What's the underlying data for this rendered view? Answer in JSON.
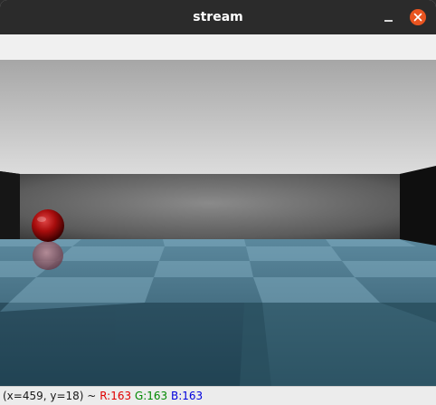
{
  "window": {
    "title": "stream"
  },
  "viewport": {
    "scene": "3d-room-with-red-sphere-on-checkerboard-floor"
  },
  "status": {
    "coords": "(x=459, y=18) ~",
    "r": "R:163",
    "g": "G:163",
    "b": "B:163"
  },
  "colors": {
    "titlebar": "#2b2b2b",
    "close_button": "#e95420",
    "r_label": "#e00000",
    "g_label": "#008800",
    "b_label": "#0000dd"
  },
  "icons": {
    "minimize": "minimize-icon",
    "close": "close-icon"
  }
}
